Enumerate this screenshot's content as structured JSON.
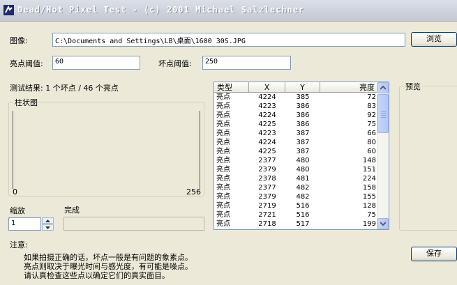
{
  "window": {
    "title": "Dead/Hot Pixel Test - (c) 2001 Michael Salzlechner"
  },
  "image": {
    "label": "图像:",
    "path": "C:\\Documents and Settings\\LB\\桌面\\1600 30S.JPG",
    "browse_label": "浏览"
  },
  "hot_threshold": {
    "label": "亮点阈值:",
    "value": "60"
  },
  "dead_threshold": {
    "label": "坏点阈值:",
    "value": "250"
  },
  "result": {
    "text": "测试结果: 1 个坏点 / 46 个亮点"
  },
  "histogram": {
    "title": "柱状图",
    "min_label": "0",
    "max_label": "256"
  },
  "zoom": {
    "label": "缩放",
    "value": "1"
  },
  "status": {
    "label": "完成"
  },
  "preview": {
    "title": "预览"
  },
  "note": {
    "title": "注意:",
    "line1": "如果拍摄正确的话，坏点一般是有问题的象素点。",
    "line2": "亮点则取决于曝光时间与感光度，有可能是噪点。",
    "line3": "请认真检查这些点以确定它们的真实面目。"
  },
  "save_label": "保存",
  "table": {
    "headers": {
      "type": "类型",
      "x": "X",
      "y": "Y",
      "brightness": "亮度"
    },
    "rows": [
      [
        "亮点",
        "4224",
        "385",
        "72"
      ],
      [
        "亮点",
        "4223",
        "386",
        "83"
      ],
      [
        "亮点",
        "4224",
        "386",
        "92"
      ],
      [
        "亮点",
        "4225",
        "386",
        "75"
      ],
      [
        "亮点",
        "4223",
        "387",
        "66"
      ],
      [
        "亮点",
        "4224",
        "387",
        "80"
      ],
      [
        "亮点",
        "4225",
        "387",
        "60"
      ],
      [
        "亮点",
        "2377",
        "480",
        "148"
      ],
      [
        "亮点",
        "2379",
        "480",
        "151"
      ],
      [
        "亮点",
        "2378",
        "481",
        "224"
      ],
      [
        "亮点",
        "2377",
        "482",
        "158"
      ],
      [
        "亮点",
        "2379",
        "482",
        "155"
      ],
      [
        "亮点",
        "2719",
        "516",
        "128"
      ],
      [
        "亮点",
        "2721",
        "516",
        "75"
      ],
      [
        "亮点",
        "2718",
        "517",
        "199"
      ]
    ]
  },
  "icons": {
    "app": "pixel-test-app-icon",
    "scroll_up": "arrow-up-icon",
    "scroll_down": "arrow-down-icon"
  }
}
